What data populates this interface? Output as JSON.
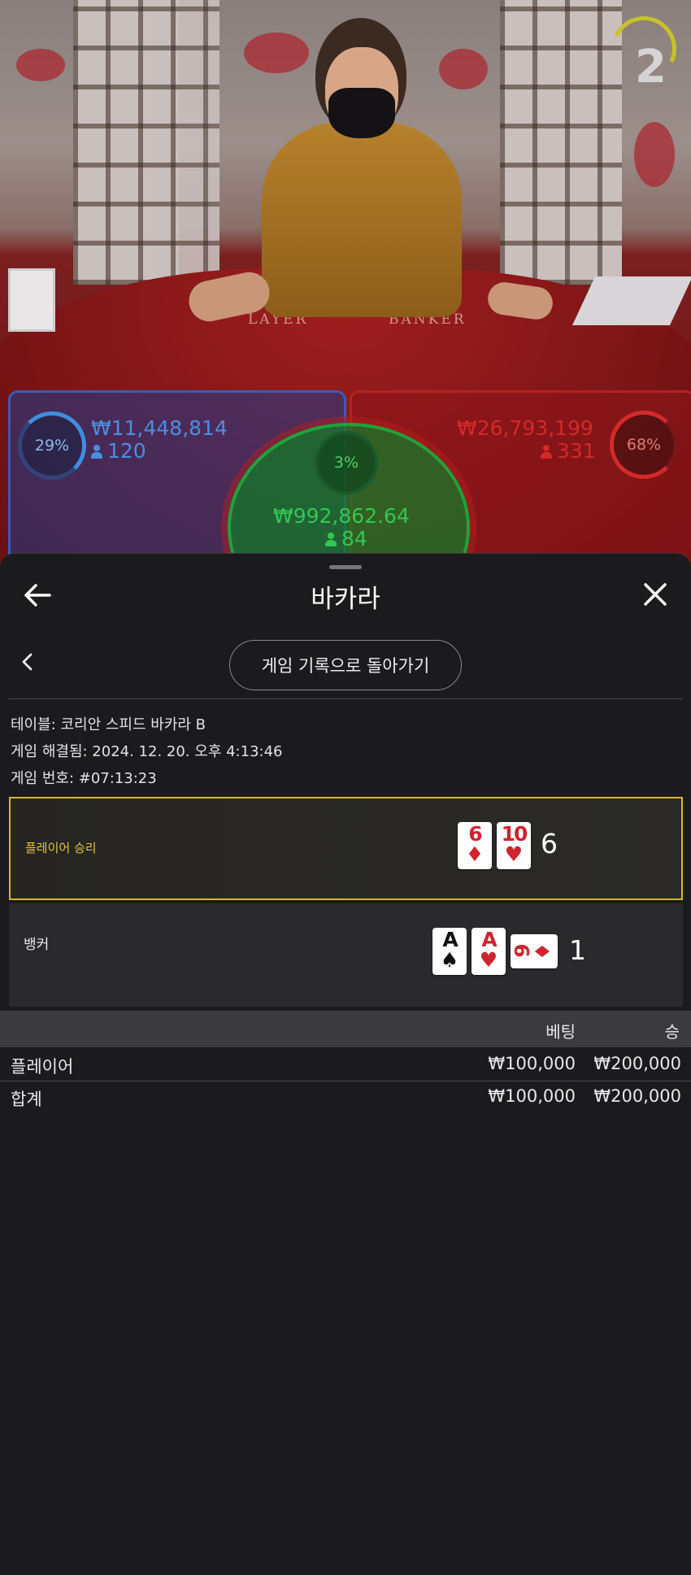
{
  "live": {
    "countdown": "2",
    "felt_player_label": "LAYER",
    "felt_banker_label": "BANKER",
    "player_percent": "29%",
    "player_amount": "₩11,448,814",
    "player_count": "120",
    "banker_percent": "68%",
    "banker_amount": "₩26,793,199",
    "banker_count": "331",
    "tie_percent": "3%",
    "tie_amount": "₩992,862.64",
    "tie_count": "84"
  },
  "sheet": {
    "title": "바카라",
    "back_to_history": "게임 기록으로 돌아가기",
    "table_line": "테이블: 코리안 스피드 바카라 B",
    "resolved_line": "게임 해결됨: 2024. 12. 20. 오후 4:13:46",
    "game_number_line": "게임 번호: #07:13:23"
  },
  "result": {
    "player": {
      "label": "플레이어 승리",
      "cards": [
        {
          "rank": "6",
          "suit": "♦",
          "color": "red"
        },
        {
          "rank": "10",
          "suit": "♥",
          "color": "red"
        }
      ],
      "total": "6"
    },
    "banker": {
      "label": "뱅커",
      "cards": [
        {
          "rank": "A",
          "suit": "♠",
          "color": "black"
        },
        {
          "rank": "A",
          "suit": "♥",
          "color": "red"
        },
        {
          "rank": "9",
          "suit": "♦",
          "color": "red"
        }
      ],
      "total": "1"
    }
  },
  "bets": {
    "header_bet": "베팅",
    "header_win": "승",
    "rows": [
      {
        "label": "플레이어",
        "bet": "₩100,000",
        "win": "₩200,000"
      }
    ],
    "total": {
      "label": "합계",
      "bet": "₩100,000",
      "win": "₩200,000"
    }
  },
  "colors": {
    "win_border": "#d8b72a",
    "win_label": "#e0c43a",
    "player_blue": "#4a8ee2",
    "banker_red": "#d22a2a",
    "tie_green": "#34c653"
  }
}
